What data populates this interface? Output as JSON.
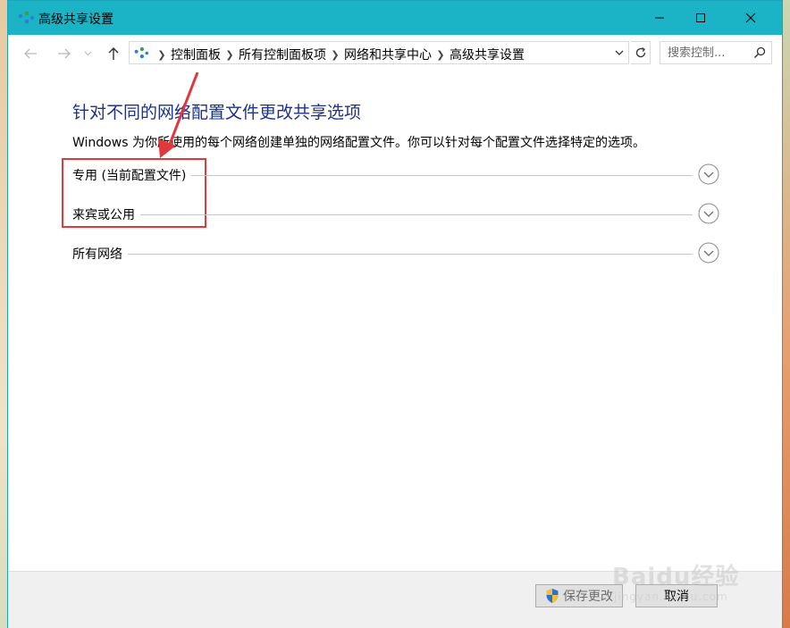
{
  "window": {
    "title": "高级共享设置",
    "accent_color": "#1ab4c6"
  },
  "address": {
    "breadcrumbs": [
      "控制面板",
      "所有控制面板项",
      "网络和共享中心",
      "高级共享设置"
    ]
  },
  "search": {
    "placeholder": "搜索控制..."
  },
  "main": {
    "heading": "针对不同的网络配置文件更改共享选项",
    "description": "Windows 为你所使用的每个网络创建单独的网络配置文件。你可以针对每个配置文件选择特定的选项。",
    "sections": [
      {
        "label": "专用 (当前配置文件)"
      },
      {
        "label": "来宾或公用"
      },
      {
        "label": "所有网络"
      }
    ]
  },
  "footer": {
    "save_label": "保存更改",
    "cancel_label": "取消"
  },
  "watermark": {
    "main": "Baidu经验",
    "sub": "jingyan.baidu.com"
  },
  "icons": [
    "network-icon",
    "minimize-icon",
    "maximize-icon",
    "close-icon",
    "back-arrow-icon",
    "forward-arrow-icon",
    "up-arrow-icon",
    "chevron-down-icon",
    "refresh-icon",
    "search-icon",
    "shield-icon"
  ]
}
